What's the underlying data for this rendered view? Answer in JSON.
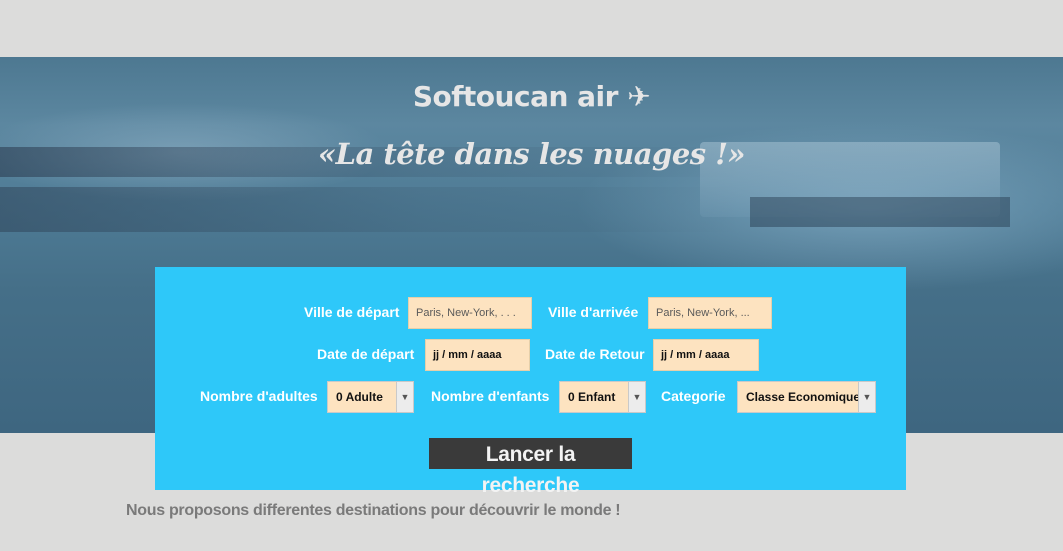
{
  "header": {
    "brand": "Softoucan air ✈",
    "slogan": "«La tête dans les nuages !»"
  },
  "form": {
    "departure_city_label": "Ville de départ",
    "departure_city_placeholder": "Paris, New-York, . . .",
    "arrival_city_label": "Ville d'arrivée",
    "arrival_city_placeholder": "Paris, New-York, ...",
    "departure_date_label": "Date de départ",
    "departure_date_value": "jj / mm / aaaa",
    "return_date_label": "Date de Retour",
    "return_date_value": "jj / mm / aaaa",
    "adults_label": "Nombre d'adultes",
    "adults_value": "0 Adulte",
    "children_label": "Nombre d'enfants",
    "children_value": "0 Enfant",
    "category_label": "Categorie",
    "category_value": "Classe Economique",
    "search_button": "Lancer la recherche"
  },
  "content": {
    "tagline": "Nous proposons differentes destinations pour découvrir le monde !"
  },
  "colors": {
    "panel": "#2ec8f9",
    "input_bg": "#fde3c0",
    "button_bg": "#3a3a3a",
    "page_bg": "#dcdcdb"
  },
  "icons": {
    "plane": "airplane-icon",
    "dropdown": "chevron-down-icon"
  }
}
